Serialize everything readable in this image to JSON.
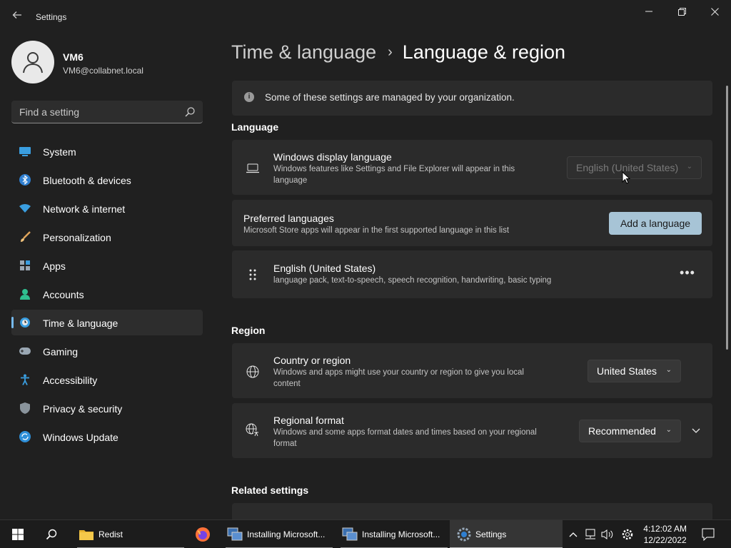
{
  "window": {
    "title": "Settings"
  },
  "profile": {
    "name": "VM6",
    "email": "VM6@collabnet.local"
  },
  "search": {
    "placeholder": "Find a setting"
  },
  "sidebar": {
    "items": [
      {
        "label": "System",
        "icon": "system-icon"
      },
      {
        "label": "Bluetooth & devices",
        "icon": "bluetooth-icon"
      },
      {
        "label": "Network & internet",
        "icon": "network-icon"
      },
      {
        "label": "Personalization",
        "icon": "brush-icon"
      },
      {
        "label": "Apps",
        "icon": "apps-icon"
      },
      {
        "label": "Accounts",
        "icon": "accounts-icon"
      },
      {
        "label": "Time & language",
        "icon": "time-language-icon",
        "selected": true
      },
      {
        "label": "Gaming",
        "icon": "gamepad-icon"
      },
      {
        "label": "Accessibility",
        "icon": "accessibility-icon"
      },
      {
        "label": "Privacy & security",
        "icon": "shield-icon"
      },
      {
        "label": "Windows Update",
        "icon": "update-icon"
      }
    ]
  },
  "breadcrumb": {
    "parent": "Time & language",
    "separator": "›",
    "current": "Language & region"
  },
  "info_bar": {
    "text": "Some of these settings are managed by your organization."
  },
  "language": {
    "section_title": "Language",
    "display_language": {
      "title": "Windows display language",
      "description": "Windows features like Settings and File Explorer will appear in this language",
      "value": "English (United States)"
    },
    "preferred": {
      "title": "Preferred languages",
      "description": "Microsoft Store apps will appear in the first supported language in this list",
      "button": "Add a language"
    },
    "installed": {
      "title": "English (United States)",
      "description": "language pack, text-to-speech, speech recognition, handwriting, basic typing",
      "more": "•••"
    }
  },
  "region": {
    "section_title": "Region",
    "country": {
      "title": "Country or region",
      "description": "Windows and apps might use your country or region to give you local content",
      "value": "United States"
    },
    "format": {
      "title": "Regional format",
      "description": "Windows and some apps format dates and times based on your regional format",
      "value": "Recommended"
    }
  },
  "related": {
    "section_title": "Related settings"
  },
  "taskbar": {
    "items": [
      {
        "label": "Redist",
        "icon": "folder-icon"
      },
      {
        "label": "",
        "icon": "firefox-icon"
      },
      {
        "label": "Installing Microsoft...",
        "icon": "installer-icon"
      },
      {
        "label": "Installing Microsoft...",
        "icon": "installer-icon"
      },
      {
        "label": "Settings",
        "icon": "settings-gear-icon"
      }
    ],
    "time": "4:12:02 AM",
    "date": "12/22/2022"
  },
  "colors": {
    "accent": "#76b9ed",
    "button_accent": "#a7c4d6",
    "background": "#202020",
    "card": "#2b2b2b"
  }
}
